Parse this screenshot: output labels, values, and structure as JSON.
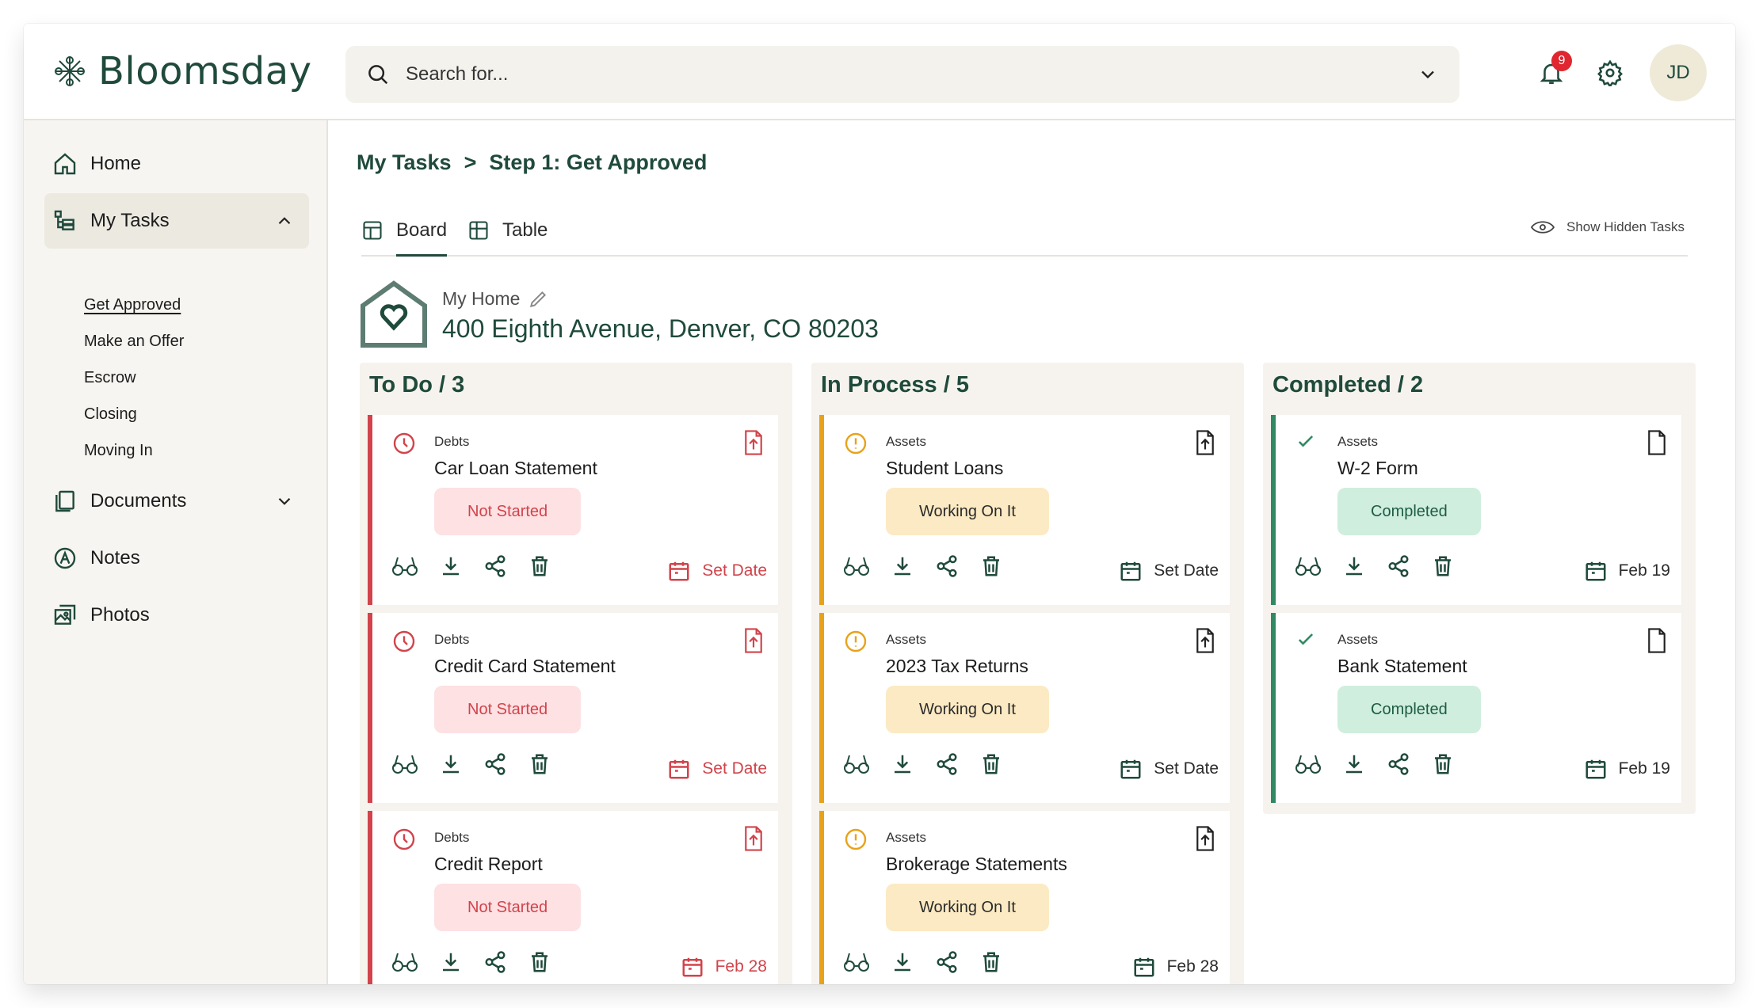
{
  "brand": {
    "name": "Bloomsday"
  },
  "search": {
    "placeholder": "Search for..."
  },
  "header": {
    "notification_count": "9",
    "avatar_initials": "JD"
  },
  "sidebar": {
    "items": [
      {
        "label": "Home",
        "icon": "home-icon"
      },
      {
        "label": "My Tasks",
        "icon": "tasks-icon"
      },
      {
        "label": "Documents",
        "icon": "documents-icon"
      },
      {
        "label": "Notes",
        "icon": "notes-icon"
      },
      {
        "label": "Photos",
        "icon": "photos-icon"
      }
    ],
    "subitems": [
      "Get Approved",
      "Make an Offer",
      "Escrow",
      "Closing",
      "Moving In"
    ]
  },
  "breadcrumb": {
    "root": "My Tasks",
    "separator": ">",
    "current": "Step 1: Get Approved"
  },
  "tabs": {
    "board": "Board",
    "table": "Table",
    "show_hidden": "Show Hidden Tasks"
  },
  "home": {
    "label": "My Home",
    "address": "400 Eighth Avenue, Denver, CO 80203"
  },
  "columns": [
    {
      "title": "To Do / 3",
      "cards": [
        {
          "category": "Debts",
          "title": "Car Loan Statement",
          "status": "Not Started",
          "date": "Set Date"
        },
        {
          "category": "Debts",
          "title": "Credit Card Statement",
          "status": "Not Started",
          "date": "Set Date"
        },
        {
          "category": "Debts",
          "title": "Credit Report",
          "status": "Not Started",
          "date": "Feb 28"
        }
      ]
    },
    {
      "title": "In Process / 5",
      "cards": [
        {
          "category": "Assets",
          "title": "Student Loans",
          "status": "Working On It",
          "date": "Set Date"
        },
        {
          "category": "Assets",
          "title": "2023 Tax Returns",
          "status": "Working On It",
          "date": "Set Date"
        },
        {
          "category": "Assets",
          "title": "Brokerage Statements",
          "status": "Working On It",
          "date": "Feb 28"
        }
      ]
    },
    {
      "title": "Completed / 2",
      "cards": [
        {
          "category": "Assets",
          "title": "W-2 Form",
          "status": "Completed",
          "date": "Feb 19"
        },
        {
          "category": "Assets",
          "title": "Bank Statement",
          "status": "Completed",
          "date": "Feb 19"
        }
      ]
    }
  ],
  "colors": {
    "brand_green": "#1f4a3c",
    "todo_red": "#d2434b",
    "process_orange": "#e8a21a",
    "done_green": "#2f8a63"
  }
}
